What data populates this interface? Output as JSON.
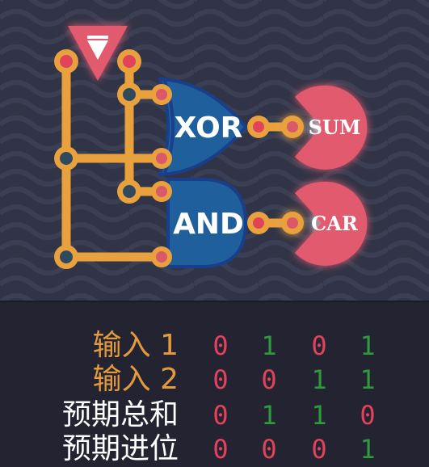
{
  "circuit": {
    "gates": [
      {
        "id": "xor",
        "label": "XOR"
      },
      {
        "id": "and",
        "label": "AND"
      }
    ],
    "outputs": [
      {
        "id": "sum",
        "label": "SUM"
      },
      {
        "id": "carry",
        "label": "CAR"
      }
    ]
  },
  "truth_table": {
    "rows": [
      {
        "label": "输入 1",
        "kind": "input",
        "values": [
          0,
          1,
          0,
          1
        ]
      },
      {
        "label": "输入 2",
        "kind": "input",
        "values": [
          0,
          0,
          1,
          1
        ]
      },
      {
        "label": "预期总和",
        "kind": "expected",
        "values": [
          0,
          1,
          1,
          0
        ]
      },
      {
        "label": "预期进位",
        "kind": "expected",
        "values": [
          0,
          0,
          0,
          1
        ]
      }
    ]
  },
  "colors": {
    "background_top": "#313446",
    "background_bottom": "#232332",
    "wire": "#e8a13c",
    "gate_fill": "#1f5f9c",
    "gate_stroke": "#1a3f8a",
    "output_fill": "#e25a6e",
    "zero": "#e0435a",
    "one": "#2e9a3c",
    "input_label": "#e39a3c",
    "expected_label": "#ffffff"
  }
}
